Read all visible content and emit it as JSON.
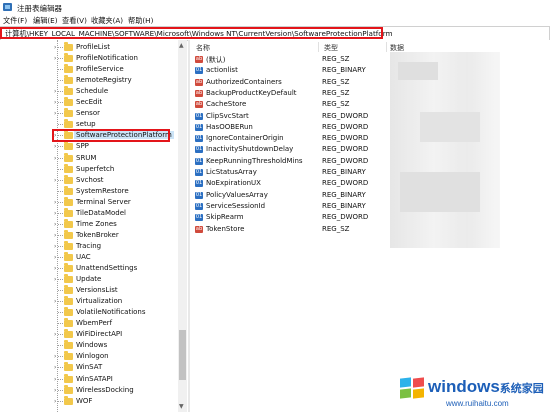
{
  "window": {
    "title": "注册表编辑器"
  },
  "menu": [
    "文件(F)",
    "编辑(E)",
    "查看(V)",
    "收藏夹(A)",
    "帮助(H)"
  ],
  "address": {
    "path": "计算机\\HKEY_LOCAL_MACHINE\\SOFTWARE\\Microsoft\\Windows NT\\CurrentVersion\\SoftwareProtectionPlatform"
  },
  "tree": {
    "items": [
      {
        "label": "ProfileList",
        "expander": "›"
      },
      {
        "label": "ProfileNotification",
        "expander": "›"
      },
      {
        "label": "ProfileService",
        "expander": ""
      },
      {
        "label": "RemoteRegistry",
        "expander": ""
      },
      {
        "label": "Schedule",
        "expander": "›"
      },
      {
        "label": "SecEdit",
        "expander": "›"
      },
      {
        "label": "Sensor",
        "expander": "›"
      },
      {
        "label": "setup",
        "expander": ""
      },
      {
        "label": "SoftwareProtectionPlatform",
        "expander": "›",
        "selected": true
      },
      {
        "label": "SPP",
        "expander": "›"
      },
      {
        "label": "SRUM",
        "expander": "›"
      },
      {
        "label": "Superfetch",
        "expander": ""
      },
      {
        "label": "Svchost",
        "expander": "›"
      },
      {
        "label": "SystemRestore",
        "expander": ""
      },
      {
        "label": "Terminal Server",
        "expander": "›"
      },
      {
        "label": "TileDataModel",
        "expander": "›"
      },
      {
        "label": "Time Zones",
        "expander": "›"
      },
      {
        "label": "TokenBroker",
        "expander": "›"
      },
      {
        "label": "Tracing",
        "expander": "›"
      },
      {
        "label": "UAC",
        "expander": "›"
      },
      {
        "label": "UnattendSettings",
        "expander": "›"
      },
      {
        "label": "Update",
        "expander": "›"
      },
      {
        "label": "VersionsList",
        "expander": ""
      },
      {
        "label": "Virtualization",
        "expander": "›"
      },
      {
        "label": "VolatileNotifications",
        "expander": ""
      },
      {
        "label": "WbemPerf",
        "expander": ""
      },
      {
        "label": "WiFiDirectAPI",
        "expander": "›"
      },
      {
        "label": "Windows",
        "expander": ""
      },
      {
        "label": "Winlogon",
        "expander": "›"
      },
      {
        "label": "WinSAT",
        "expander": "›"
      },
      {
        "label": "WinSATAPI",
        "expander": "›"
      },
      {
        "label": "WirelessDocking",
        "expander": "›"
      },
      {
        "label": "WOF",
        "expander": "›"
      }
    ]
  },
  "list": {
    "headers": {
      "name": "名称",
      "type": "类型",
      "data": "数据"
    },
    "rows": [
      {
        "name": "(默认)",
        "type": "REG_SZ",
        "kind": "sz"
      },
      {
        "name": "actionlist",
        "type": "REG_BINARY",
        "kind": "bin"
      },
      {
        "name": "AuthorizedContainers",
        "type": "REG_SZ",
        "kind": "sz"
      },
      {
        "name": "BackupProductKeyDefault",
        "type": "REG_SZ",
        "kind": "sz"
      },
      {
        "name": "CacheStore",
        "type": "REG_SZ",
        "kind": "sz"
      },
      {
        "name": "ClipSvcStart",
        "type": "REG_DWORD",
        "kind": "bin"
      },
      {
        "name": "HasOOBERun",
        "type": "REG_DWORD",
        "kind": "bin"
      },
      {
        "name": "IgnoreContainerOrigin",
        "type": "REG_DWORD",
        "kind": "bin"
      },
      {
        "name": "InactivityShutdownDelay",
        "type": "REG_DWORD",
        "kind": "bin"
      },
      {
        "name": "KeepRunningThresholdMins",
        "type": "REG_DWORD",
        "kind": "bin"
      },
      {
        "name": "LicStatusArray",
        "type": "REG_BINARY",
        "kind": "bin"
      },
      {
        "name": "NoExpirationUX",
        "type": "REG_DWORD",
        "kind": "bin"
      },
      {
        "name": "PolicyValuesArray",
        "type": "REG_BINARY",
        "kind": "bin"
      },
      {
        "name": "ServiceSessionId",
        "type": "REG_BINARY",
        "kind": "bin"
      },
      {
        "name": "SkipRearm",
        "type": "REG_DWORD",
        "kind": "bin"
      },
      {
        "name": "TokenStore",
        "type": "REG_SZ",
        "kind": "sz"
      }
    ]
  },
  "watermark": {
    "brand": "windows",
    "suffix": "系统家园",
    "url": "www.ruihaitu.com"
  },
  "colors": {
    "highlight": "#e3151a",
    "selection": "#cce4f7",
    "brand": "#1d5fb8"
  }
}
